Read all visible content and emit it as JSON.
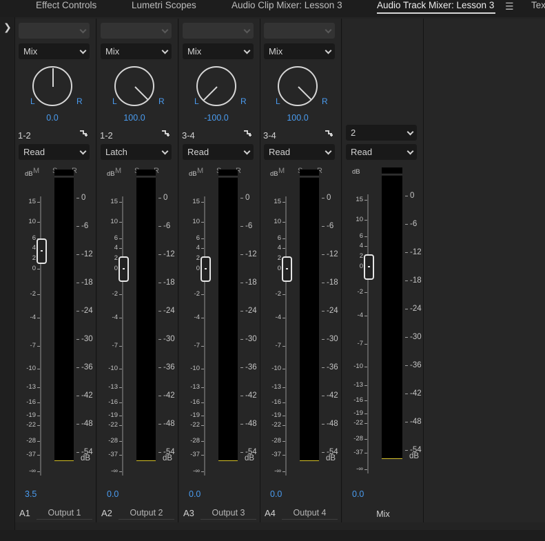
{
  "tabs": [
    {
      "label": "Effect Controls",
      "active": false
    },
    {
      "label": "Lumetri Scopes",
      "active": false
    },
    {
      "label": "Audio Clip Mixer: Lesson 3",
      "active": false
    },
    {
      "label": "Audio Track Mixer: Lesson 3",
      "active": true
    },
    {
      "label": "Tex",
      "active": false
    }
  ],
  "menu_icon": "☰",
  "expand_icon": "chevron-right-icon",
  "colors": {
    "value_blue": "#4a9cf0",
    "meter_peak": "#d8c42c",
    "panel_bg": "#262626"
  },
  "fader_scale": {
    "unit": "dB",
    "left_ticks": [
      "15",
      "10",
      "6",
      "4",
      "2",
      "0",
      "-2",
      "-4",
      "-7",
      "-10",
      "-13",
      "-16",
      "-19",
      "-22",
      "-28",
      "-37",
      "-∞"
    ],
    "right_ticks": [
      "0",
      "-6",
      "-12",
      "-18",
      "-24",
      "-30",
      "-36",
      "-42",
      "-48",
      "-54"
    ],
    "right_unit": "dB"
  },
  "strips": [
    {
      "effect_select": "",
      "mode": "Mix",
      "pan_left": "L",
      "pan_right": "R",
      "pan_value": "0.0",
      "pan_numeric": 0,
      "channel": "1-2",
      "automation": "Read",
      "msr": [
        "M",
        "S",
        "R"
      ],
      "volume": "3.5",
      "volume_numeric": 3.5,
      "track": "A1",
      "output": "Output 1"
    },
    {
      "effect_select": "",
      "mode": "Mix",
      "pan_left": "L",
      "pan_right": "R",
      "pan_value": "100.0",
      "pan_numeric": 100,
      "channel": "1-2",
      "automation": "Latch",
      "msr": [
        "M",
        "S",
        "R"
      ],
      "volume": "0.0",
      "volume_numeric": 0,
      "track": "A2",
      "output": "Output 2"
    },
    {
      "effect_select": "",
      "mode": "Mix",
      "pan_left": "L",
      "pan_right": "R",
      "pan_value": "-100.0",
      "pan_numeric": -100,
      "channel": "3-4",
      "automation": "Read",
      "msr": [
        "M",
        "S",
        "R"
      ],
      "volume": "0.0",
      "volume_numeric": 0,
      "track": "A3",
      "output": "Output 3"
    },
    {
      "effect_select": "",
      "mode": "Mix",
      "pan_left": "L",
      "pan_right": "R",
      "pan_value": "100.0",
      "pan_numeric": 100,
      "channel": "3-4",
      "automation": "Read",
      "msr": [
        "M",
        "S",
        "R"
      ],
      "volume": "0.0",
      "volume_numeric": 0,
      "track": "A4",
      "output": "Output 4"
    }
  ],
  "master": {
    "channel_select": "2",
    "automation": "Read",
    "volume": "0.0",
    "volume_numeric": 0,
    "name": "Mix"
  }
}
